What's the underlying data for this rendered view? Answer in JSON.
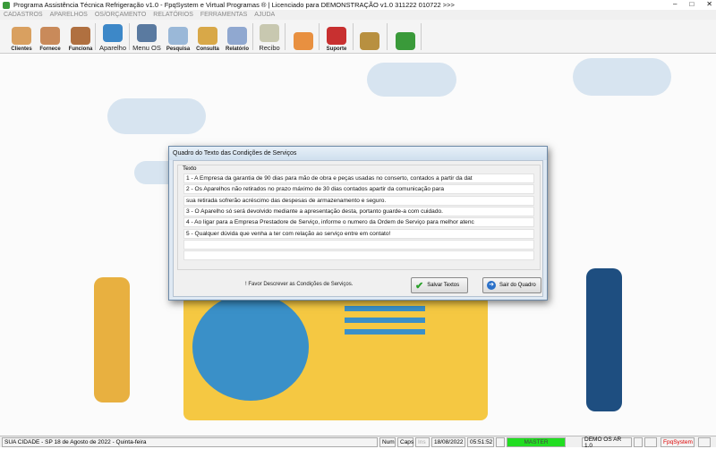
{
  "window": {
    "title": "Programa Assistência Técnica Refrigeração v1.0 - FpqSystem e Virtual Programas ® | Licenciado para  DEMONSTRAÇÃO v1.0 311222 010722 >>>",
    "controls": [
      "–",
      "□",
      "✕"
    ]
  },
  "menu": [
    "CADASTROS",
    "APARELHOS",
    "OS/ORÇAMENTO",
    "RELATÓRIOS",
    "FERRAMENTAS",
    "AJUDA"
  ],
  "toolbar": [
    {
      "label": "Clientes",
      "icon": "clients-icon",
      "color": "#d9a060"
    },
    {
      "label": "Fornece",
      "icon": "supplier-icon",
      "color": "#c98a5a"
    },
    {
      "label": "Funciona",
      "icon": "employee-icon",
      "color": "#b07040"
    },
    {
      "label": "Aparelho",
      "icon": "air-conditioner-icon",
      "color": "#3d88c8"
    },
    {
      "label": "Menu OS",
      "icon": "tools-icon",
      "color": "#5a7aa0"
    },
    {
      "label": "Pesquisa",
      "icon": "search-icon",
      "color": "#9ab8d8"
    },
    {
      "label": "Consulta",
      "icon": "folder-icon",
      "color": "#d8a848"
    },
    {
      "label": "Relatório",
      "icon": "printer-icon",
      "color": "#90a8d0"
    },
    {
      "label": "Recibo",
      "icon": "receipt-icon",
      "color": "#c8c8b0"
    },
    {
      "label": "",
      "icon": "calculator-icon",
      "color": "#e89040"
    },
    {
      "label": "Suporte",
      "icon": "support-icon",
      "color": "#c83030"
    },
    {
      "label": "",
      "icon": "coin-icon",
      "color": "#b89040"
    },
    {
      "label": "",
      "icon": "exit-icon",
      "color": "#3a9a3a"
    }
  ],
  "dialog": {
    "title": "Quadro do Texto das Condições de Serviços",
    "group_label": "Texto",
    "rows": [
      "1 - A Empresa da garantia de 90 dias para mão de obra e peças usadas no conserto, contados  a partir da dat",
      "2 - Os Aparelhos não retirados no prazo máximo de 30 dias contados apartir da comunicação para",
      "sua retirada sofrerão acréscimo das despesas de armazenamento e seguro.",
      "3 - O Aparelho só será devolvido mediante a apresentação desta, portanto guarde-a com cuidado.",
      "4 - Ao ligar para a Empresa Prestadore de Serviço, informe o numero da Ordem de Serviço para melhor atenc",
      "5 - Qualquer dúvida que venha a ter com relação ao serviço entre em contato!",
      "",
      ""
    ],
    "message": "! Favor Descrever as Condições de Serviços.",
    "save_label": "Salvar Textos",
    "exit_label": "Sair do Quadro"
  },
  "status": {
    "city_date": "SUA CIDADE - SP 18 de Agosto de 2022 - Quinta-feira",
    "num": "Num",
    "caps": "Caps",
    "ins": "Ins",
    "date": "18/08/2022",
    "time": "05:51:52",
    "user": "MASTER",
    "user_color": "#22dd22",
    "version": "DEMO OS AR 1.0",
    "brand": "FpqSystem"
  }
}
